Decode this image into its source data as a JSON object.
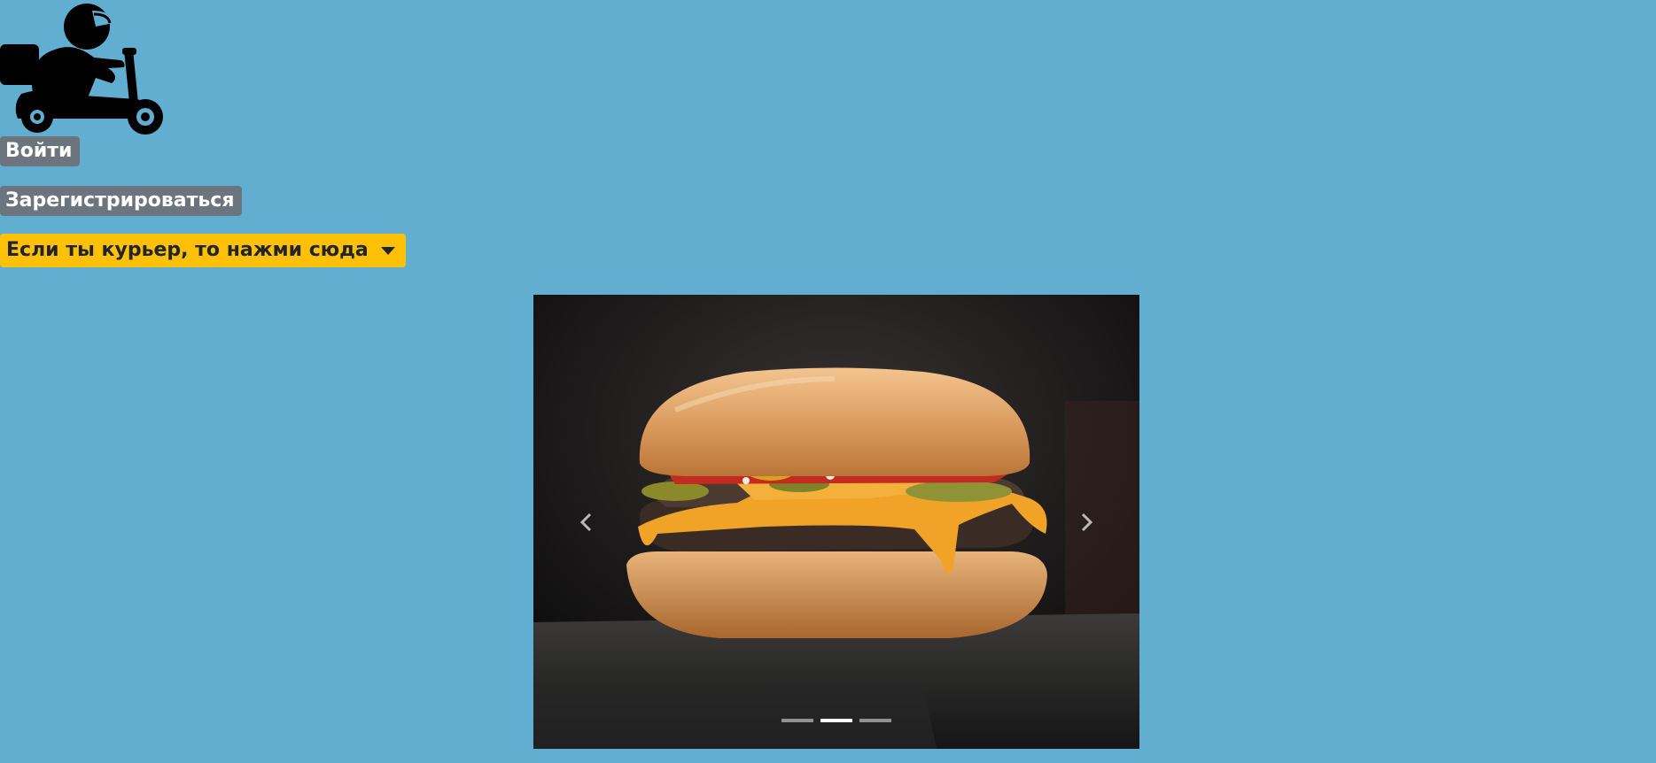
{
  "header": {
    "logo_icon": "delivery-scooter-courier-icon"
  },
  "auth": {
    "login_label": "Войти",
    "register_label": "Зарегистрироваться"
  },
  "courier_dropdown": {
    "label": "Если ты курьер, то нажми сюда",
    "color": "#ffc107"
  },
  "carousel": {
    "image": "burger-photo",
    "slide_count": 3,
    "active_index": 1,
    "prev_icon": "chevron-left-icon",
    "next_icon": "chevron-right-icon"
  },
  "colors": {
    "background": "#62aed0",
    "button_gray": "#6c757d"
  }
}
